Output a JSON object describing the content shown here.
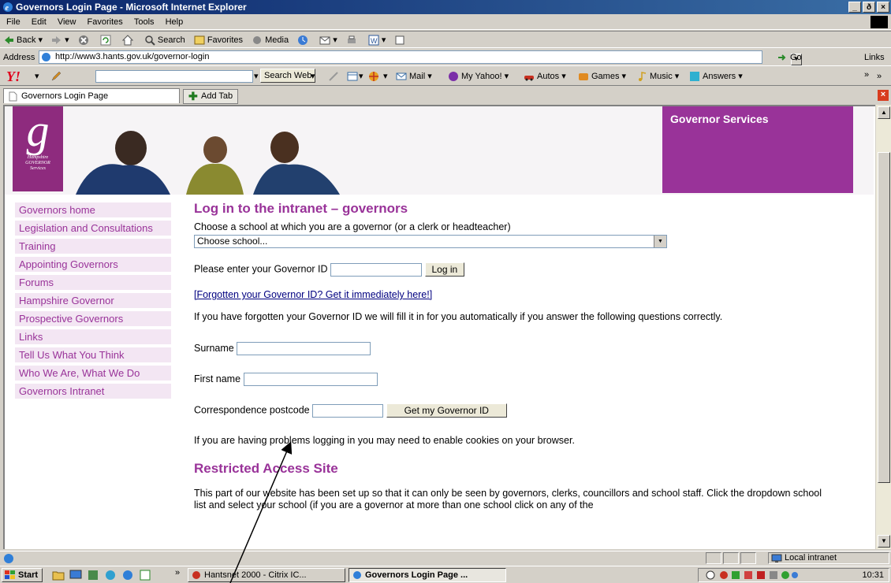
{
  "window": {
    "title": "Governors Login Page - Microsoft Internet Explorer",
    "min": "_",
    "max": "ð",
    "close": "×"
  },
  "menu": [
    "File",
    "Edit",
    "View",
    "Favorites",
    "Tools",
    "Help"
  ],
  "toolbar": {
    "back": "Back",
    "search": "Search",
    "favorites": "Favorites",
    "media": "Media"
  },
  "address": {
    "label": "Address",
    "url": "http://www3.hants.gov.uk/governor-login",
    "go": "Go",
    "links": "Links"
  },
  "yahoo": {
    "logo": "Y!",
    "search_web": "Search Web",
    "mail": "Mail",
    "my_yahoo": "My Yahoo!",
    "autos": "Autos",
    "games": "Games",
    "music": "Music",
    "answers": "Answers"
  },
  "tabs": {
    "active": "Governors Login Page",
    "add": "Add Tab"
  },
  "header": {
    "logo_letter": "g",
    "logo_line1": "Hampshire",
    "logo_line2": "GOVERNOR",
    "logo_line3": "Services",
    "section": "Governor Services"
  },
  "sidebar": [
    "Governors home",
    "Legislation and Consultations",
    "Training",
    "Appointing Governors",
    "Forums",
    "Hampshire Governor",
    "Prospective Governors",
    "Links",
    "Tell Us What You Think",
    "Who We Are, What We Do",
    "Governors Intranet"
  ],
  "main": {
    "heading": "Log in to the intranet – governors",
    "choose_label": "Choose a school at which you are a governor (or a clerk or headteacher)",
    "choose_selected": "Choose school...",
    "id_label": "Please enter your Governor ID",
    "login_button": "Log in",
    "forgot_link": "[Forgotten your Governor ID? Get it immediately here!]",
    "forgot_text": "If you have forgotten your Governor ID we will fill it in for you automatically if you answer the following questions correctly.",
    "surname_label": "Surname",
    "firstname_label": "First name",
    "postcode_label": "Correspondence postcode",
    "get_id_button": "Get my Governor ID",
    "cookies_text": "If you are having problems logging in you may need to enable cookies on your browser.",
    "restricted_heading": "Restricted Access Site",
    "restricted_text": "This part of our website has been set up so that it can only be seen by governors, clerks, councillors and school staff. Click the dropdown school list and select your school (if you are a governor at more than one school click on any of the"
  },
  "status": {
    "zone": "Local intranet"
  },
  "taskbar": {
    "start": "Start",
    "more": "»",
    "task1": "Hantsnet 2000 - Citrix IC...",
    "task2": "Governors Login Page ...",
    "clock": "10:31"
  },
  "colors": {
    "brand_purple": "#993399",
    "nav_bg": "#f3e6f3",
    "title_blue": "#0a246a"
  }
}
